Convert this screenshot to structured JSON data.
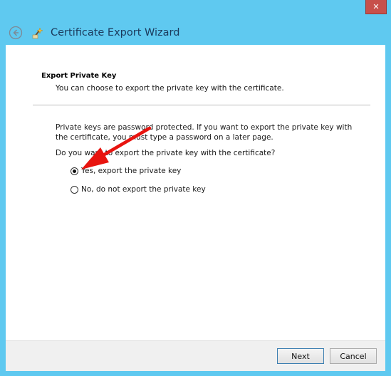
{
  "window": {
    "title": "Certificate Export Wizard",
    "close_glyph": "✕",
    "frame_color": "#5fc9f0",
    "close_color": "#c7504b"
  },
  "page": {
    "heading": "Export Private Key",
    "description": "You can choose to export the private key with the certificate.",
    "body": "Private keys are password protected. If you want to export the private key with the certificate, you must type a password on a later page.",
    "question": "Do you want to export the private key with the certificate?",
    "options": [
      {
        "label": "Yes, export the private key",
        "selected": true
      },
      {
        "label": "No, do not export the private key",
        "selected": false
      }
    ]
  },
  "footer": {
    "next_label": "Next",
    "cancel_label": "Cancel"
  },
  "annotation": {
    "type": "arrow",
    "color": "#e8140f"
  }
}
